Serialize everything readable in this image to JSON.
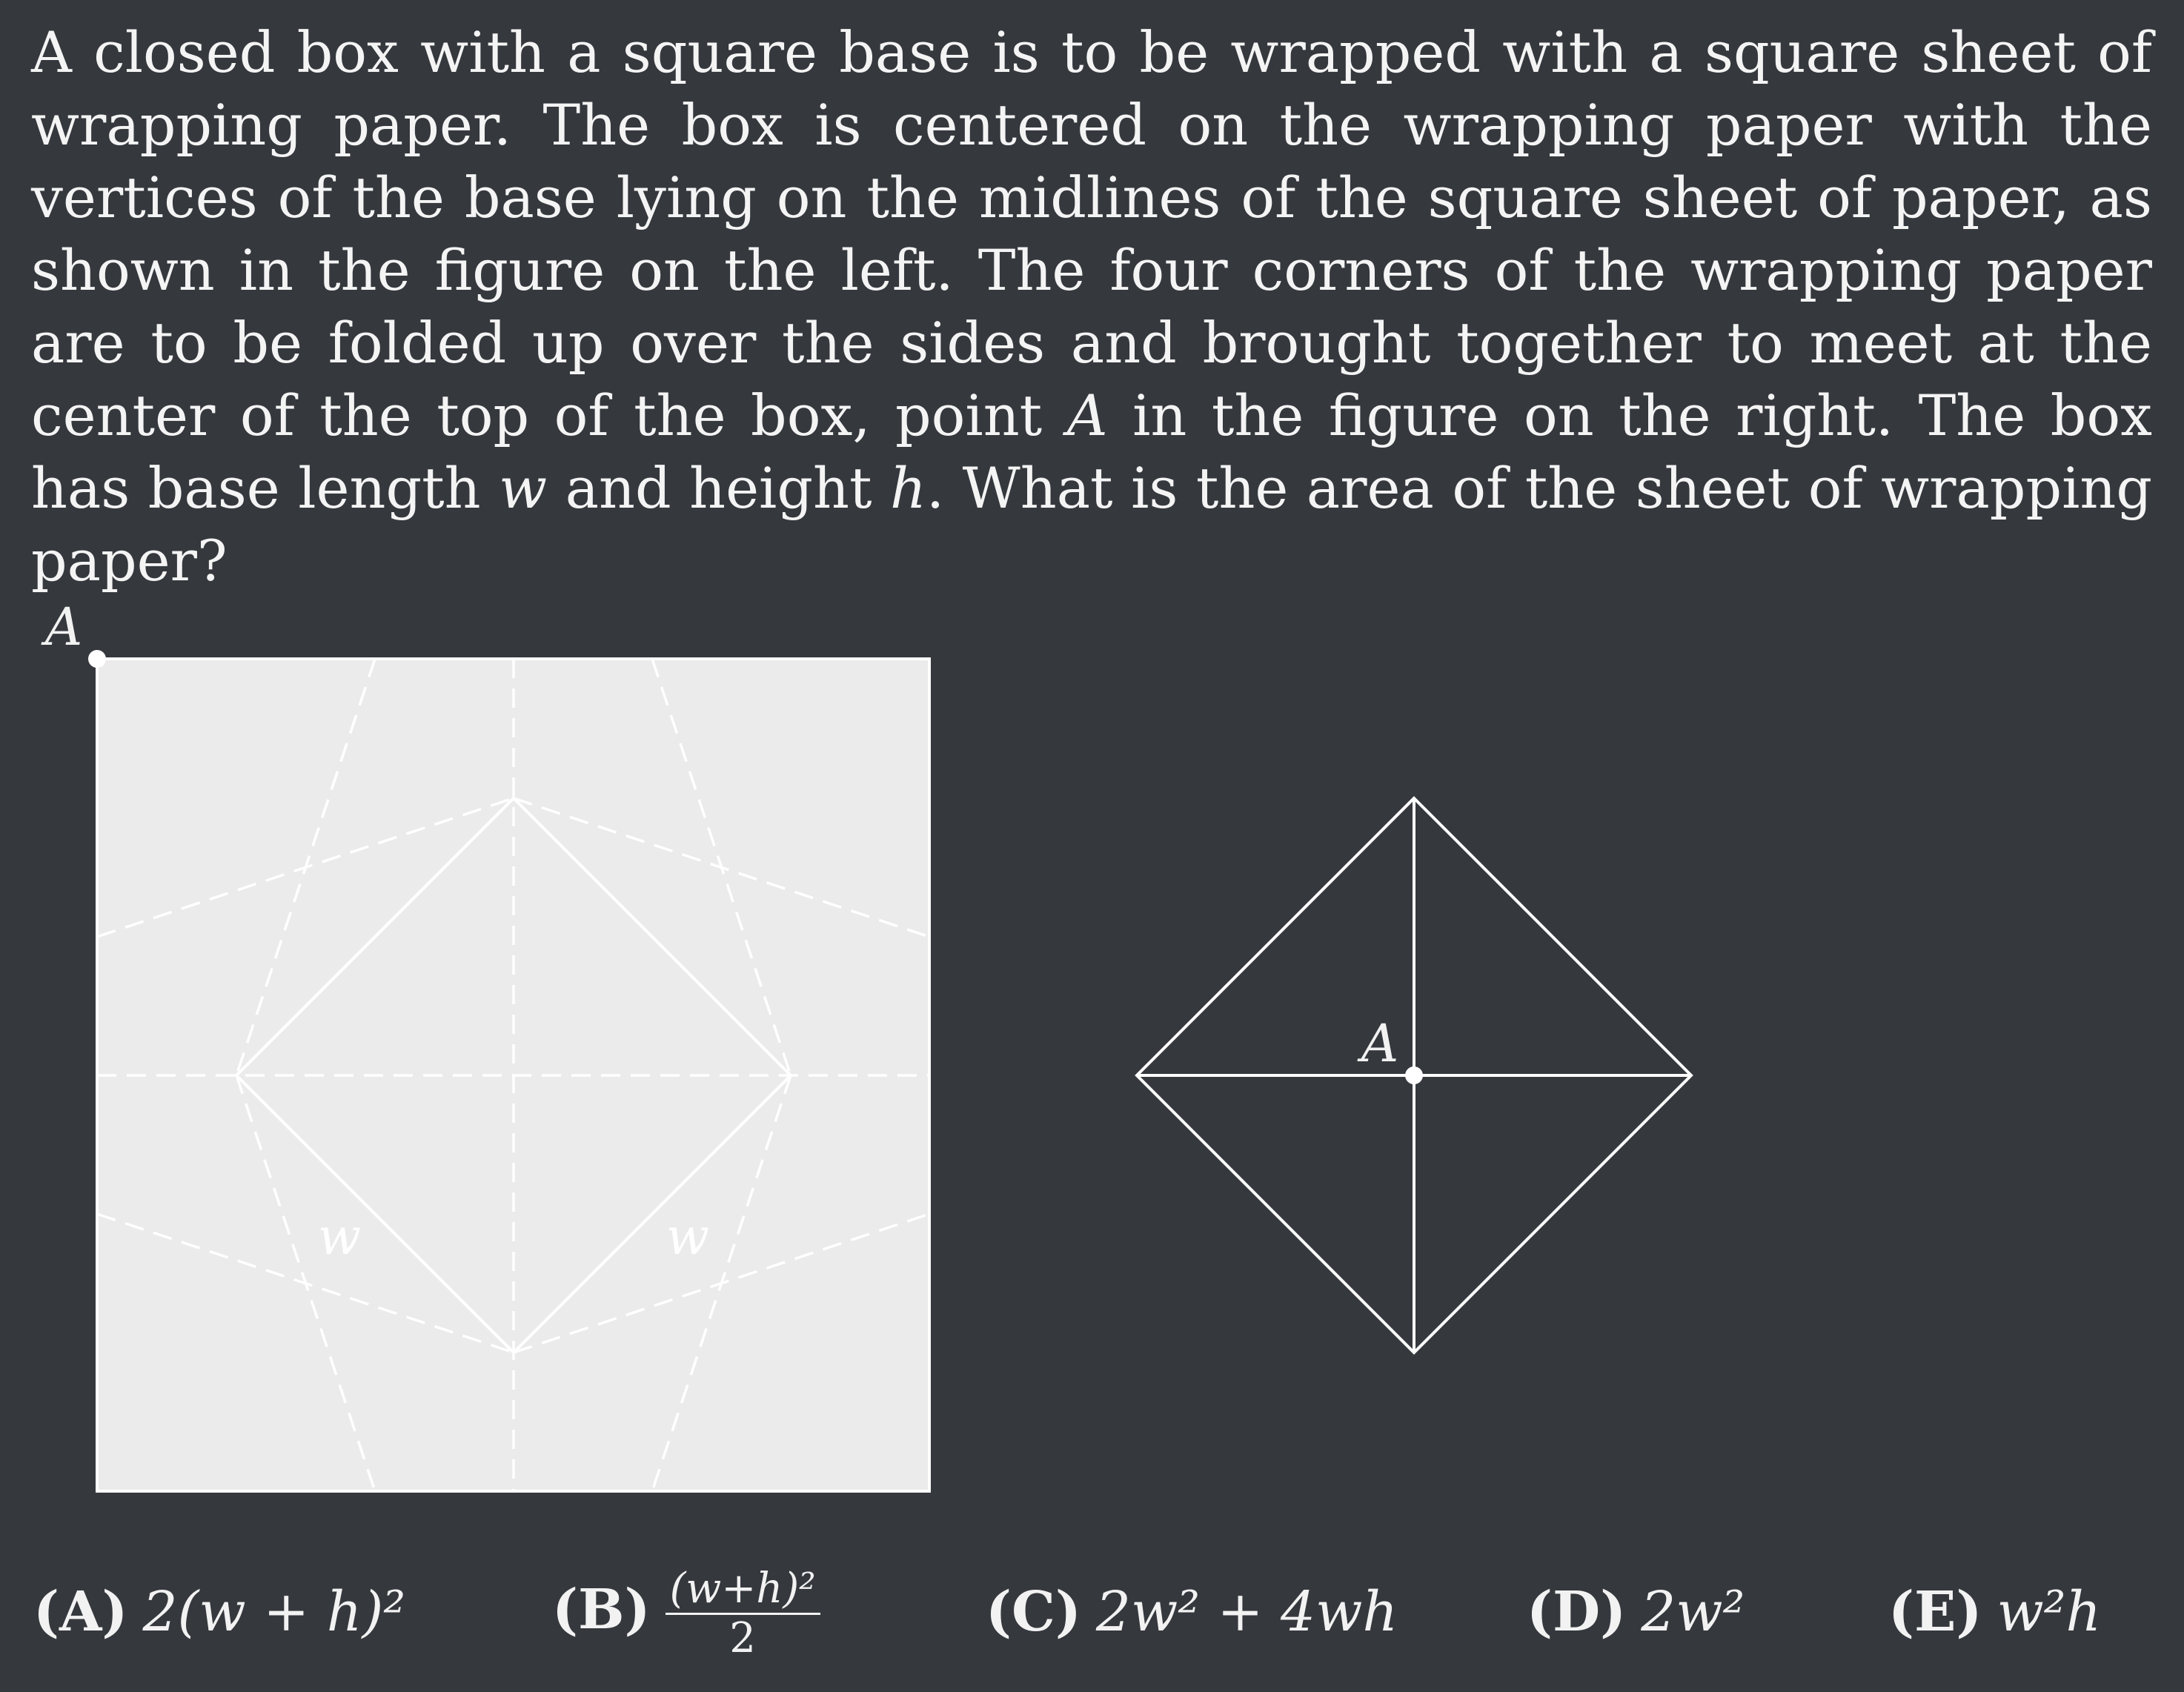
{
  "problem": {
    "part1": "A closed box with a square base is to be wrapped with a square sheet of wrapping paper. The box is centered on the wrapping paper with the vertices of the base lying on the midlines of the square sheet of paper, as shown in the figure on the left. The four corners of the wrapping paper are to be folded up over the sides and brought together to meet at the center of the top of the box, point ",
    "point_var": "A",
    "part2": " in the figure on the right. The box has base length ",
    "w_var": "w",
    "part3": " and height ",
    "h_var": "h",
    "part4": ". What is the area of the sheet of wrapping paper?"
  },
  "figure": {
    "left_point_label": "A",
    "w_label_left": "w",
    "w_label_right": "w",
    "right_point_label": "A",
    "paper_color": "#ebebeb",
    "line_color": "#ffffff",
    "background_color": "#35383d"
  },
  "choices": [
    {
      "label": "(A)",
      "expr": "2(w + h)²"
    },
    {
      "label": "(B)",
      "numerator": "(w+h)²",
      "denominator": "2"
    },
    {
      "label": "(C)",
      "expr": "2w² + 4wh"
    },
    {
      "label": "(D)",
      "expr": "2w²"
    },
    {
      "label": "(E)",
      "expr": "w²h"
    }
  ]
}
